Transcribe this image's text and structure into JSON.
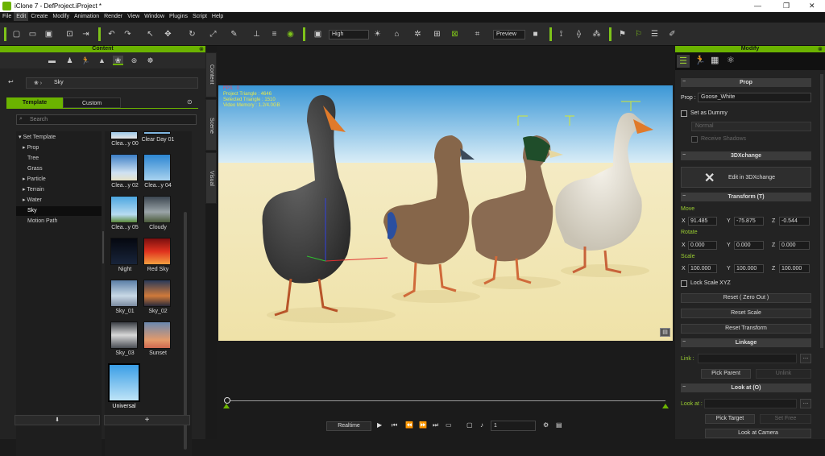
{
  "window": {
    "title": "iClone 7 - DefProject.iProject *",
    "min": "—",
    "max": "❐",
    "close": "✕"
  },
  "menu": [
    "File",
    "Edit",
    "Create",
    "Modify",
    "Animation",
    "Render",
    "View",
    "Window",
    "Plugins",
    "Script",
    "Help"
  ],
  "toolbar": {
    "quality": "High",
    "preview": "Preview"
  },
  "content_panel": {
    "title": "Content",
    "path": "Sky",
    "tabs": [
      "Template",
      "Custom"
    ],
    "search_placeholder": "Search",
    "tree": [
      "Set Template",
      "Prop",
      "Tree",
      "Grass",
      "Particle",
      "Terrain",
      "Water",
      "Sky",
      "Motion Path"
    ],
    "thumbs": [
      "Clea...y 00",
      "Clear Day 01",
      "Clea...y 02",
      "Clea...y 04",
      "Clea...y 05",
      "Cloudy",
      "Night",
      "Red Sky",
      "Sky_01",
      "Sky_02",
      "Sky_03",
      "Sunset",
      "Universal"
    ],
    "bottom_add": "+",
    "bottom_down": "⬇"
  },
  "side_tabs": [
    "Content",
    "Scene",
    "Visual"
  ],
  "viewport": {
    "stats": [
      "FPS : 0",
      "Project Triangle : 4646",
      "Selected Triangle : 1510",
      "Video Memory : 1.2/4.0GB"
    ]
  },
  "timeline": {
    "realtime": "Realtime",
    "frame": "1"
  },
  "modify_panel": {
    "title": "Modify",
    "prop_section": "Prop",
    "prop_label": "Prop :",
    "prop_name": "Goose_White",
    "set_dummy": "Set as Dummy",
    "normal": "Normal",
    "receive_shadows": "Receive Shadows",
    "xchange_section": "3DXchange",
    "xchange_btn": "Edit in 3DXchange",
    "transform_section": "Transform  (T)",
    "move": "Move",
    "rotate": "Rotate",
    "scale": "Scale",
    "move_vals": [
      "91.485",
      "-75.875",
      "-0.544"
    ],
    "rotate_vals": [
      "0.000",
      "0.000",
      "0.000"
    ],
    "scale_vals": [
      "100.000",
      "100.000",
      "100.000"
    ],
    "xyz": [
      "X",
      "Y",
      "Z"
    ],
    "lock_scale": "Lock Scale XYZ",
    "reset_zero": "Reset ( Zero Out )",
    "reset_scale": "Reset Scale",
    "reset_transform": "Reset Transform",
    "linkage_section": "Linkage",
    "link": "Link :",
    "pick_parent": "Pick Parent",
    "unlink": "Unlink",
    "lookat_section": "Look at  (O)",
    "look_at": "Look at :",
    "pick_target": "Pick Target",
    "set_free": "Set Free",
    "look_camera": "Look at Camera"
  },
  "colors": {
    "accent": "#6bb300",
    "sky_top": "#4aa6dc",
    "ground": "#f2e6b0"
  }
}
